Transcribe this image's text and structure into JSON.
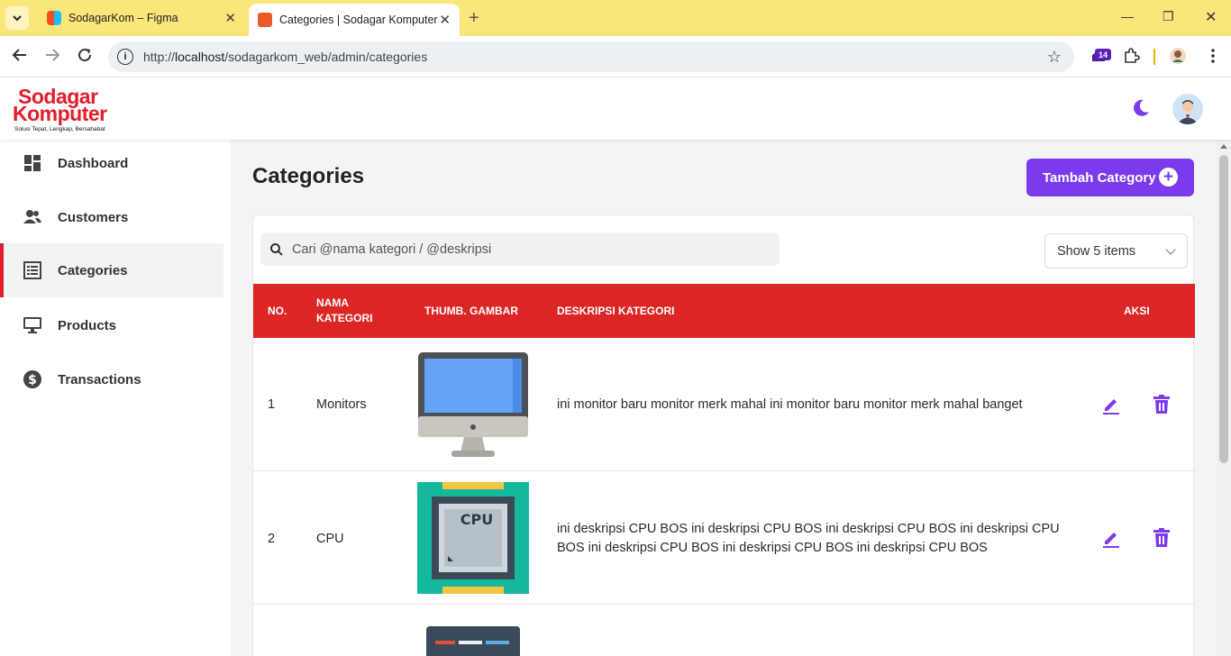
{
  "browser": {
    "tabs": [
      {
        "title": "SodagarKom – Figma",
        "active": false
      },
      {
        "title": "Categories | Sodagar Komputer",
        "active": true
      }
    ],
    "url_prefix": "http://",
    "url_host": "localhost",
    "url_path": "/sodagarkom_web/admin/categories",
    "extension_badge": "14"
  },
  "header": {
    "logo_line1": "Sodagar",
    "logo_line2": "Komputer",
    "logo_tagline": "Solusi Tepat, Lengkap, Bersahabat",
    "theme_icon": "moon-icon",
    "avatar_icon": "user-avatar"
  },
  "sidebar": {
    "items": [
      {
        "label": "Dashboard",
        "icon": "dashboard-icon",
        "active": false
      },
      {
        "label": "Customers",
        "icon": "users-icon",
        "active": false
      },
      {
        "label": "Categories",
        "icon": "list-icon",
        "active": true
      },
      {
        "label": "Products",
        "icon": "monitor-icon",
        "active": false
      },
      {
        "label": "Transactions",
        "icon": "dollar-icon",
        "active": false
      }
    ]
  },
  "main": {
    "title": "Categories",
    "add_button": "Tambah Category",
    "search_placeholder": "Cari @nama kategori / @deskripsi",
    "show_select": "Show 5 items",
    "columns": [
      "NO.",
      "NAMA KATEGORI",
      "THUMB. GAMBAR",
      "DESKRIPSI KATEGORI",
      "AKSI"
    ],
    "rows": [
      {
        "no": "1",
        "name": "Monitors",
        "thumb": "monitor-thumbnail",
        "desc": "ini monitor baru monitor merk mahal ini monitor baru monitor merk mahal banget"
      },
      {
        "no": "2",
        "name": "CPU",
        "thumb": "cpu-thumbnail",
        "thumb_text": "CPU",
        "desc": "ini deskripsi CPU BOS ini deskripsi CPU BOS ini deskripsi CPU BOS ini deskripsi CPU BOS ini deskripsi CPU BOS ini deskripsi CPU BOS ini deskripsi CPU BOS"
      }
    ]
  },
  "colors": {
    "accent": "#7c3aed",
    "table_header": "#dc2626",
    "brand": "#e11d2a"
  }
}
